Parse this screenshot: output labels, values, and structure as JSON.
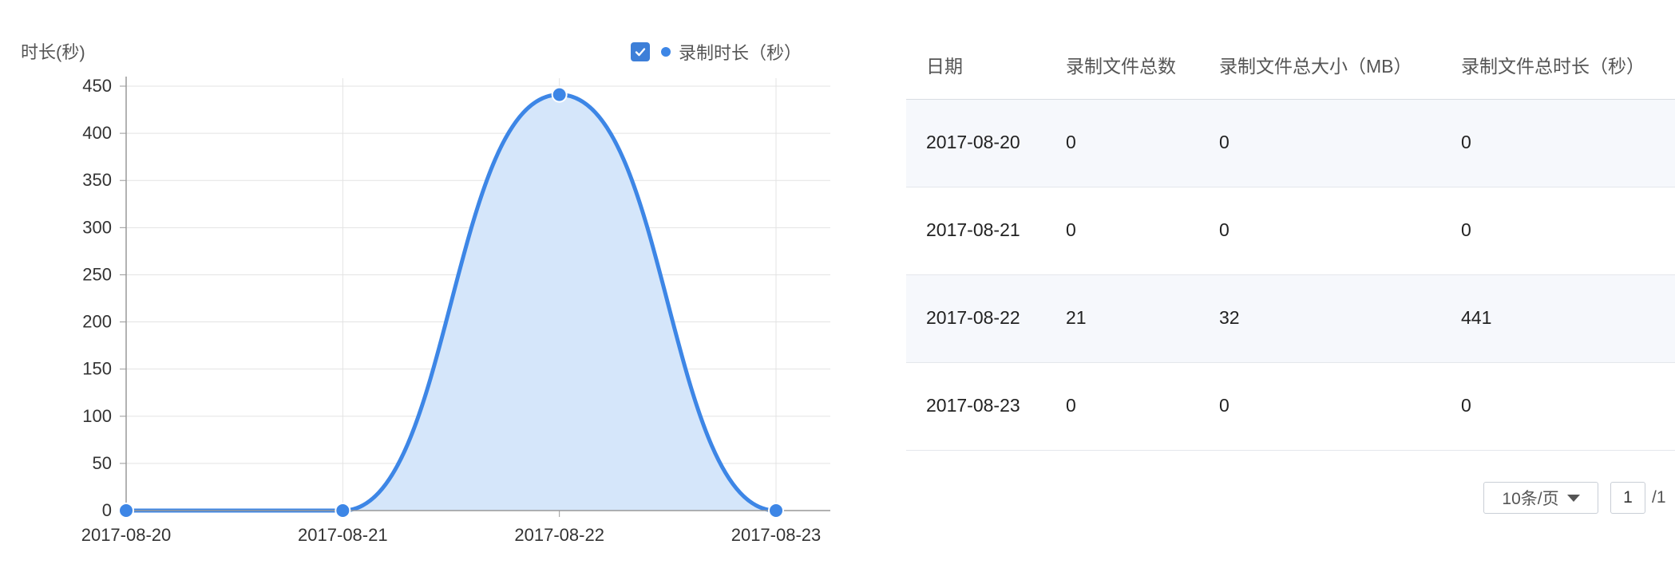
{
  "chart": {
    "y_axis_label": "时长(秒)",
    "legend_label": "录制时长（秒）",
    "legend_checked": true,
    "accent_color": "#3d86e6",
    "fill_color": "#d5e6fa"
  },
  "chart_data": {
    "type": "area",
    "categories": [
      "2017-08-20",
      "2017-08-21",
      "2017-08-22",
      "2017-08-23"
    ],
    "series": [
      {
        "name": "录制时长（秒）",
        "values": [
          0,
          0,
          441,
          0
        ]
      }
    ],
    "ylabel": "时长(秒)",
    "ylim": [
      0,
      450
    ],
    "yticks": [
      0,
      50,
      100,
      150,
      200,
      250,
      300,
      350,
      400,
      450
    ],
    "grid": true,
    "smooth": true,
    "legend_position": "top-right"
  },
  "table": {
    "headers": [
      "日期",
      "录制文件总数",
      "录制文件总大小（MB）",
      "录制文件总时长（秒）"
    ],
    "rows": [
      [
        "2017-08-20",
        "0",
        "0",
        "0"
      ],
      [
        "2017-08-21",
        "0",
        "0",
        "0"
      ],
      [
        "2017-08-22",
        "21",
        "32",
        "441"
      ],
      [
        "2017-08-23",
        "0",
        "0",
        "0"
      ]
    ]
  },
  "pagination": {
    "page_size_label": "10条/页",
    "current_page": "1",
    "total_pages": "/1"
  }
}
